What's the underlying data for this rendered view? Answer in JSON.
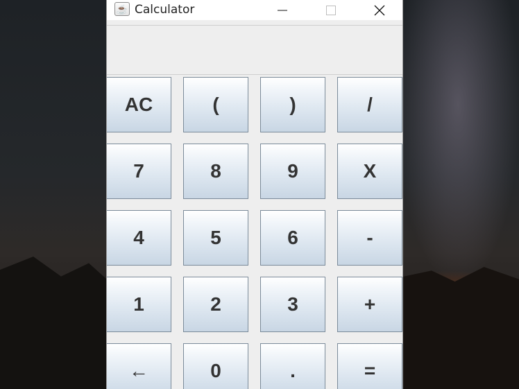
{
  "window": {
    "title": "Calculator",
    "icon": "java-cup-icon",
    "controls": {
      "minimize": "minimize-icon",
      "maximize": "maximize-icon",
      "close": "close-icon"
    }
  },
  "display": {
    "value": ""
  },
  "keypad": {
    "rows": [
      [
        "AC",
        "(",
        ")",
        "/"
      ],
      [
        "7",
        "8",
        "9",
        "X"
      ],
      [
        "4",
        "5",
        "6",
        "-"
      ],
      [
        "1",
        "2",
        "3",
        "+"
      ],
      [
        "←",
        "0",
        ".",
        "="
      ]
    ],
    "names": [
      [
        "all-clear-button",
        "open-paren-button",
        "close-paren-button",
        "divide-button"
      ],
      [
        "digit-7-button",
        "digit-8-button",
        "digit-9-button",
        "multiply-button"
      ],
      [
        "digit-4-button",
        "digit-5-button",
        "digit-6-button",
        "subtract-button"
      ],
      [
        "digit-1-button",
        "digit-2-button",
        "digit-3-button",
        "add-button"
      ],
      [
        "backspace-button",
        "digit-0-button",
        "decimal-point-button",
        "equals-button"
      ]
    ]
  },
  "colors": {
    "button_top": "#ffffff",
    "button_bottom": "#c8d6e4",
    "button_border": "#7a8a99",
    "window_bg": "#eeeeee"
  }
}
